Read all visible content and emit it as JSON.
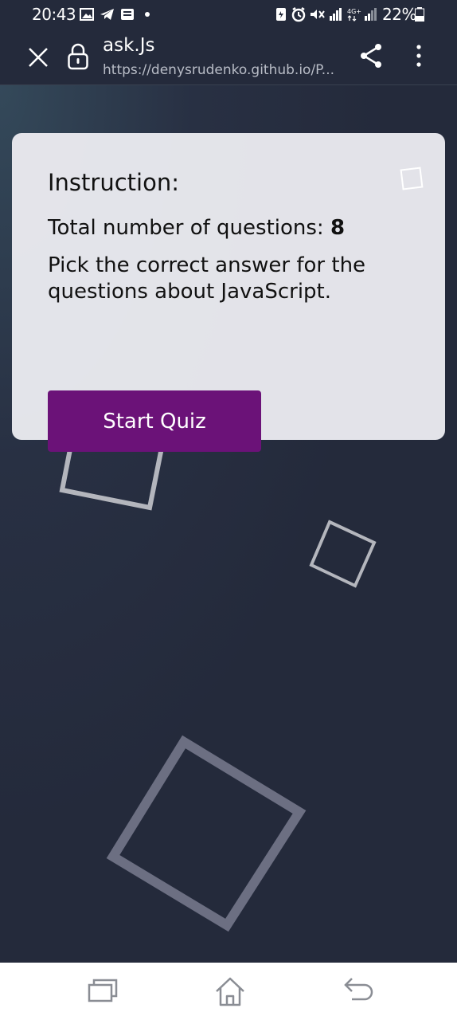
{
  "status_bar": {
    "time": "20:43",
    "battery": "22%",
    "left_icons": [
      "gallery-icon",
      "telegram-icon",
      "message-icon",
      "dot-icon"
    ],
    "right_icons": [
      "battery-saver-icon",
      "alarm-icon",
      "mute-icon",
      "signal-icon",
      "4g-icon",
      "signal-icon",
      "battery-icon"
    ]
  },
  "toolbar": {
    "page_title": "ask.Js",
    "url": "https://denysrudenko.github.io/P...",
    "close_icon": "close-icon",
    "lock_icon": "lock-icon",
    "share_icon": "share-icon",
    "more_icon": "more-vertical-icon"
  },
  "instruction_card": {
    "heading": "Instruction:",
    "count_label": "Total number of questions: ",
    "count_value": "8",
    "description": "Pick the correct answer for the questions about JavaScript.",
    "start_button": "Start Quiz"
  },
  "colors": {
    "background": "#242a3b",
    "card": "#ebebf0",
    "button": "#6b1278",
    "button_text": "#ffffff"
  },
  "nav_bar": {
    "icons": [
      "recent-apps-icon",
      "home-icon",
      "back-icon"
    ]
  }
}
